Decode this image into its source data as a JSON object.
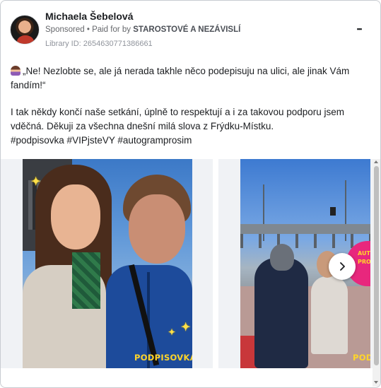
{
  "post": {
    "author": "Michaela Šebelová",
    "sponsored_label": "Sponsored",
    "separator": "•",
    "paid_for_prefix": "Paid for by",
    "sponsor_name": "STAROSTOVÉ A NEZÁVISLÍ",
    "library_id": "Library ID: 2654630771386661",
    "more_icon": "more-horizontal-icon",
    "more_glyph": "•••",
    "text_line1": "„Ne! Nezlobte se, ale já nerada takhle něco podepisuju na ulici, ale jinak Vám fandím!“",
    "text_line2": "I tak někdy končí naše setkání, úplně to respektují a i za takovou podporu jsem vděčná. Děkuji za všechna dnešní milá slova z Frýdku-Místku.",
    "hashtags": "#podpisovka #VIPjsteVY #autogramprosim"
  },
  "carousel": {
    "slide1_brand": "PODPISOVKA",
    "slide2_brand": "PODP",
    "slide2_sign_text_1": "AUTOGR",
    "slide2_sign_text_2": "PROS",
    "next_icon": "chevron-right-icon"
  },
  "colors": {
    "text": "#1c1e21",
    "meta": "#65676b",
    "brand_yellow": "#ffd52a",
    "pink": "#e8277d"
  }
}
